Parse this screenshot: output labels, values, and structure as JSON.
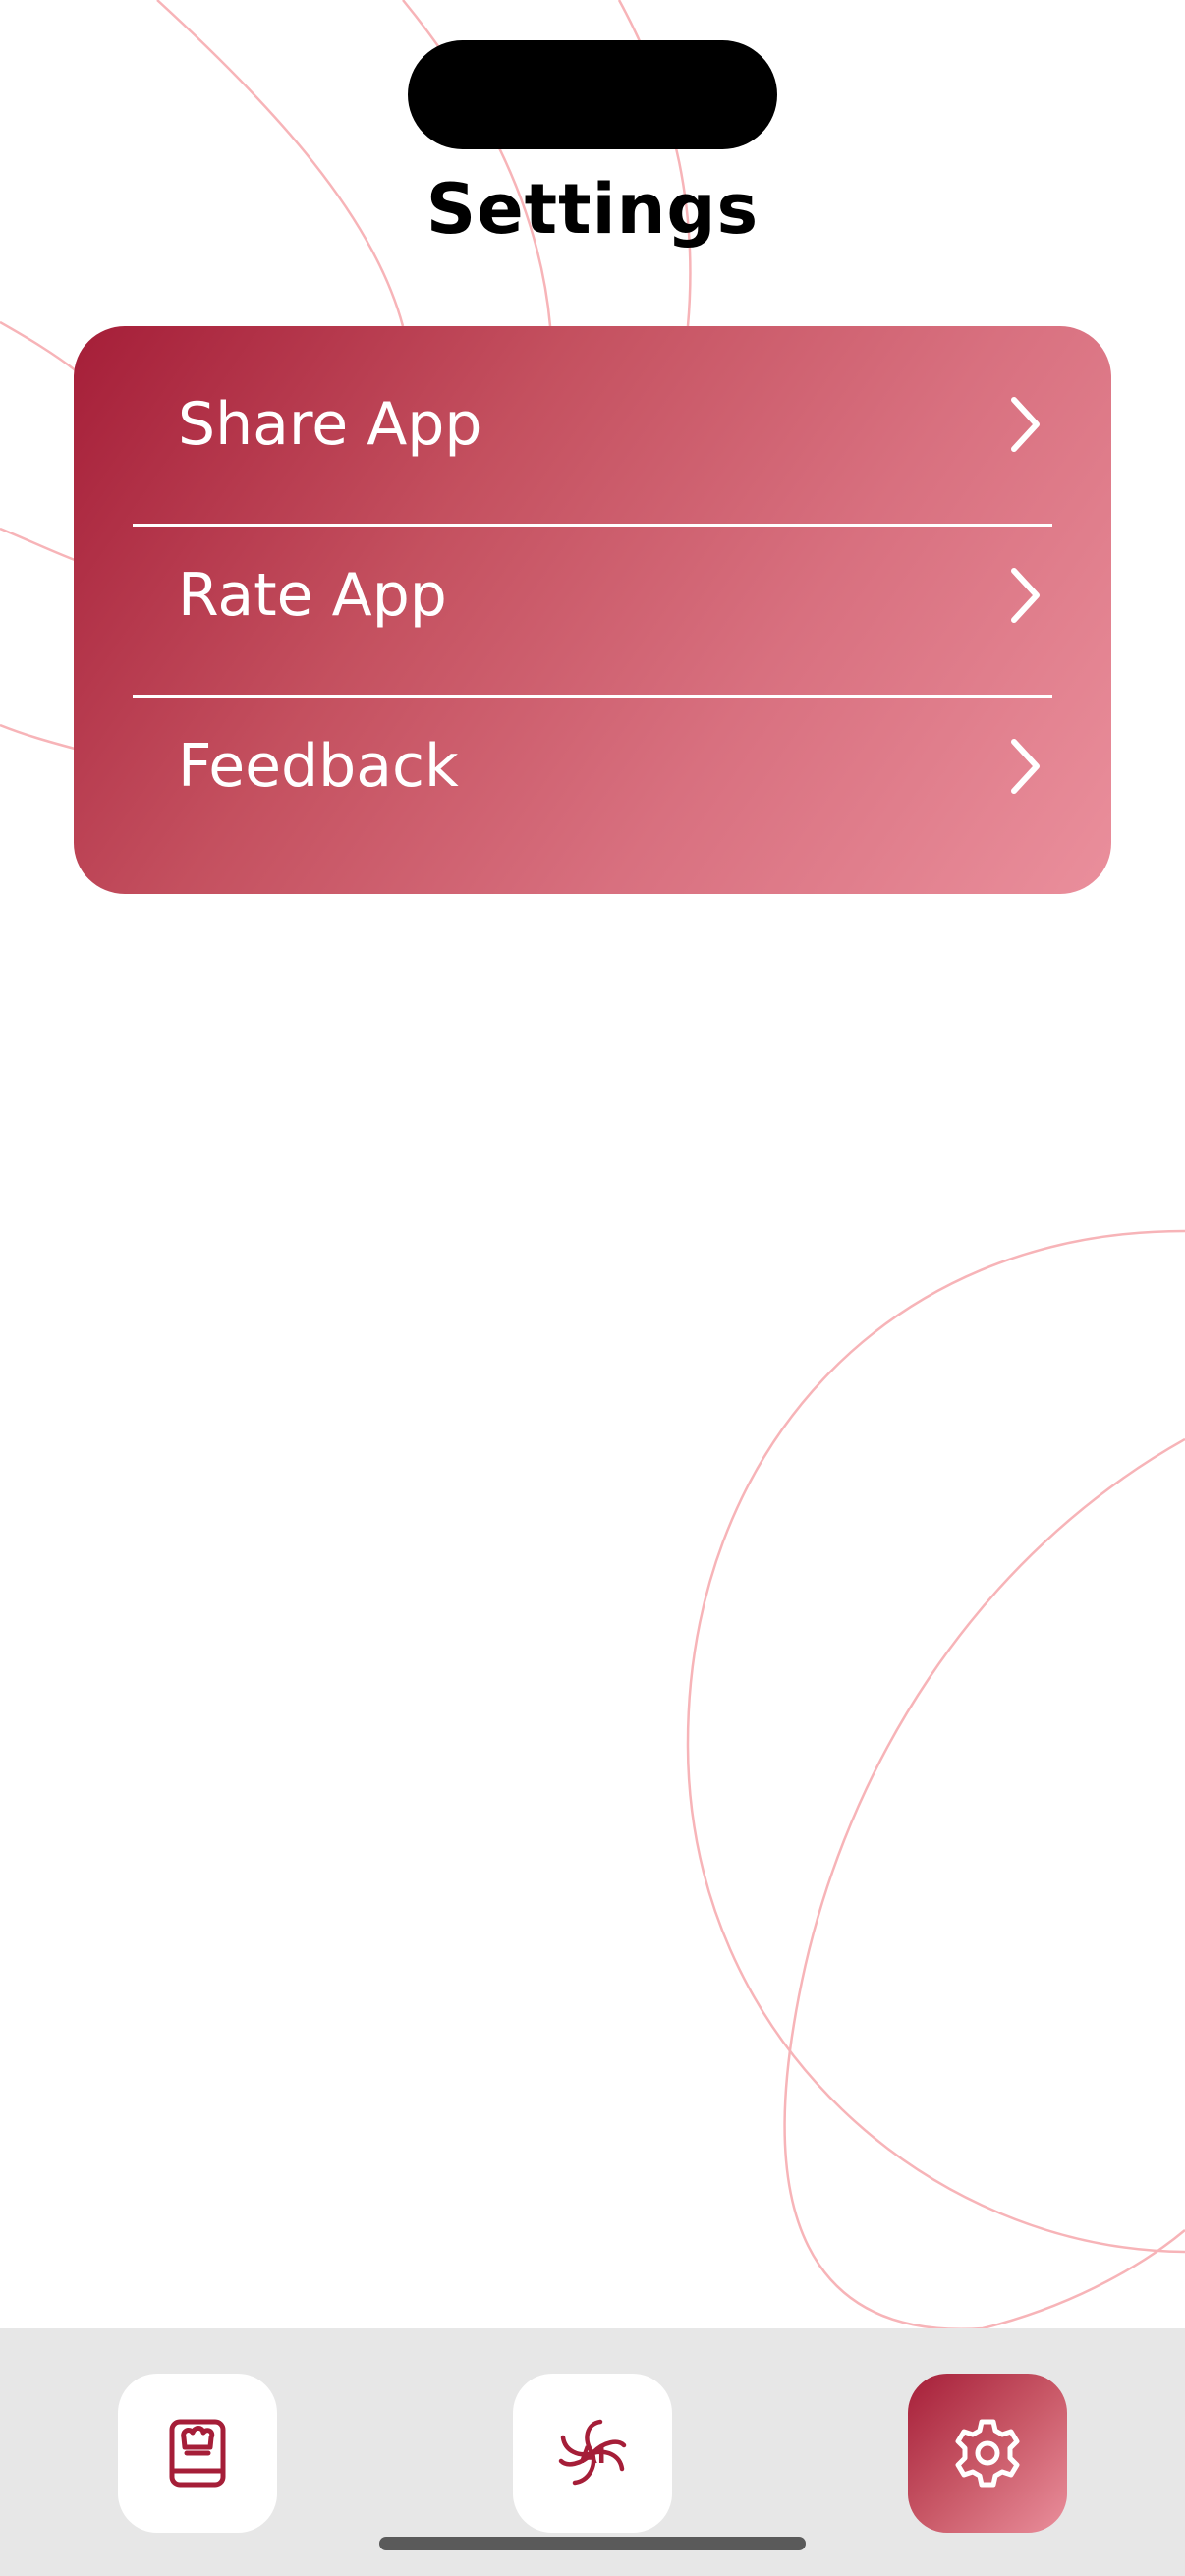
{
  "page": {
    "title": "Settings"
  },
  "settings": {
    "items": [
      {
        "label": "Share App",
        "icon": "chevron-right-icon"
      },
      {
        "label": "Rate App",
        "icon": "chevron-right-icon"
      },
      {
        "label": "Feedback",
        "icon": "chevron-right-icon"
      }
    ]
  },
  "tab_bar": {
    "tabs": [
      {
        "name": "recipes",
        "icon": "recipe-book-icon",
        "active": false
      },
      {
        "name": "ai",
        "icon": "ai-flower-icon",
        "active": false
      },
      {
        "name": "settings",
        "icon": "gear-icon",
        "active": true
      }
    ]
  },
  "colors": {
    "accent": "#a51e38",
    "accent_light": "#ea8f9c",
    "background_curve": "#f7b4b8",
    "tab_bar_background": "#e7e7e7"
  }
}
